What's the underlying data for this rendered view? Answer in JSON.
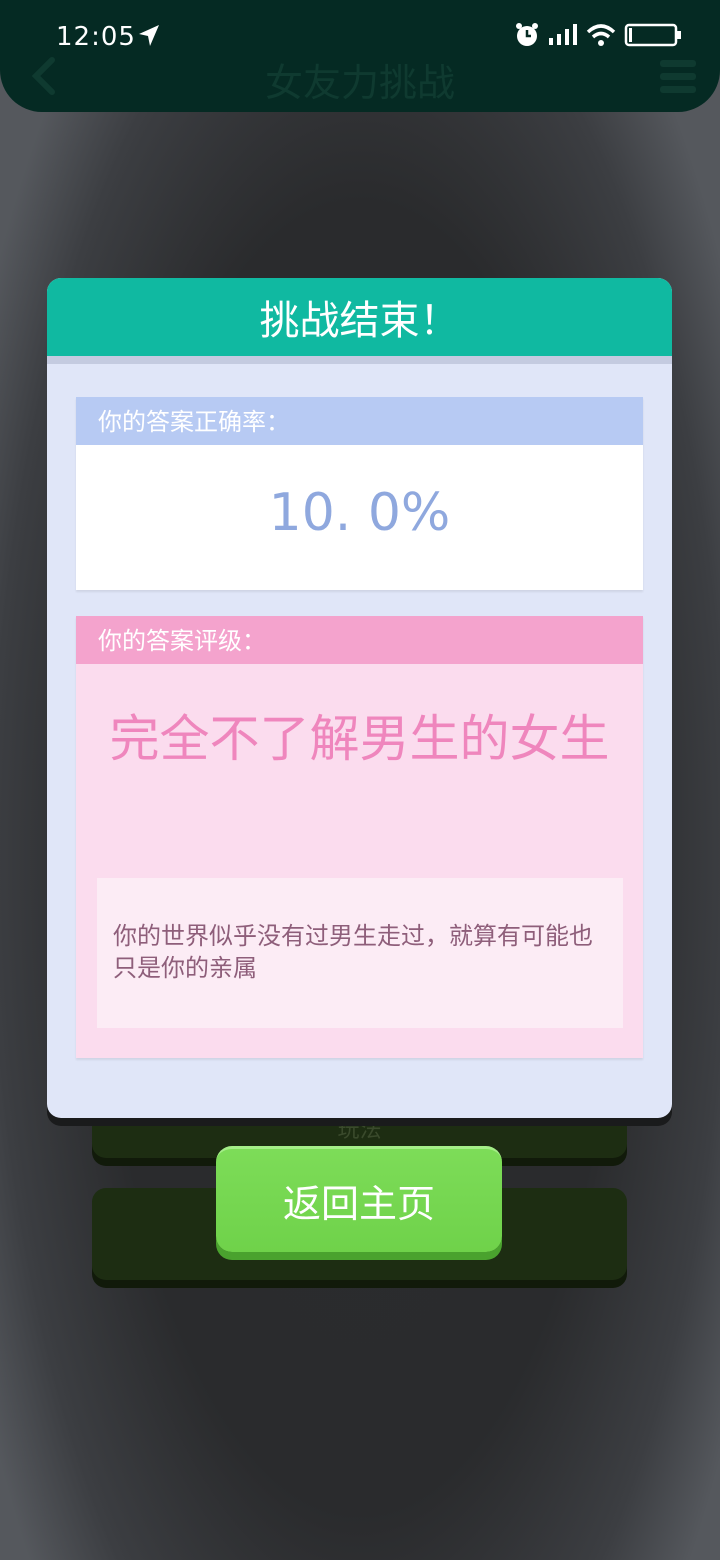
{
  "status_bar": {
    "time": "12:05"
  },
  "nav": {
    "title": "女友力挑战"
  },
  "background_buttons": {
    "partial_label": "玩法"
  },
  "modal": {
    "title": "挑战结束！",
    "accuracy": {
      "label": "你的答案正确率：",
      "value": "10. 0%"
    },
    "grade": {
      "label": "你的答案评级：",
      "title": "完全不了解男生的女生",
      "description": "你的世界似乎没有过男生走过，就算有可能也只是你的亲属"
    }
  },
  "home_button": {
    "label": "返回主页"
  },
  "colors": {
    "modal_header": "#10b9a1",
    "accuracy_header": "#b7caf3",
    "grade_header": "#f4a3cd",
    "home_button": "#76d94f"
  }
}
